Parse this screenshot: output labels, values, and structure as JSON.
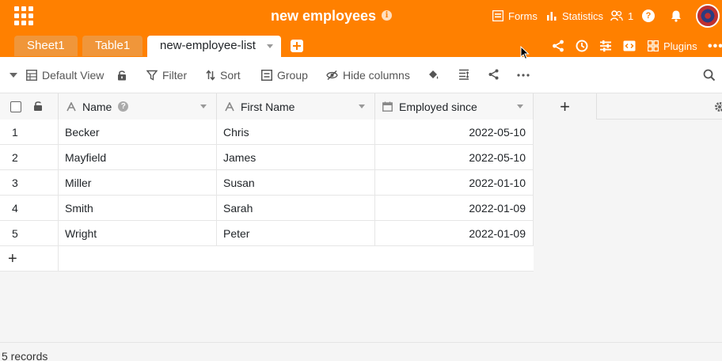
{
  "header": {
    "base_title": "new employees",
    "forms_label": "Forms",
    "statistics_label": "Statistics",
    "collaborators_count": "1",
    "help_label": "?",
    "plugins_label": "Plugins",
    "more_label": "•••"
  },
  "tabs": [
    {
      "label": "Sheet1",
      "active": false
    },
    {
      "label": "Table1",
      "active": false
    },
    {
      "label": "new-employee-list",
      "active": true
    }
  ],
  "toolbar": {
    "view_label": "Default View",
    "filter_label": "Filter",
    "sort_label": "Sort",
    "group_label": "Group",
    "hide_columns_label": "Hide columns"
  },
  "table": {
    "columns": [
      {
        "label": "Name",
        "type": "text"
      },
      {
        "label": "First Name",
        "type": "text"
      },
      {
        "label": "Employed since",
        "type": "date"
      }
    ],
    "rows": [
      {
        "index": "1",
        "name": "Becker",
        "first_name": "Chris",
        "employed_since": "2022-05-10"
      },
      {
        "index": "2",
        "name": "Mayfield",
        "first_name": "James",
        "employed_since": "2022-05-10"
      },
      {
        "index": "3",
        "name": "Miller",
        "first_name": "Susan",
        "employed_since": "2022-01-10"
      },
      {
        "index": "4",
        "name": "Smith",
        "first_name": "Sarah",
        "employed_since": "2022-01-09"
      },
      {
        "index": "5",
        "name": "Wright",
        "first_name": "Peter",
        "employed_since": "2022-01-09"
      }
    ],
    "add_column_label": "+",
    "add_row_label": "+"
  },
  "footer": {
    "record_count": "5 records"
  },
  "colors": {
    "brand": "#ff8000",
    "inactive_tab": "#f0963a"
  }
}
